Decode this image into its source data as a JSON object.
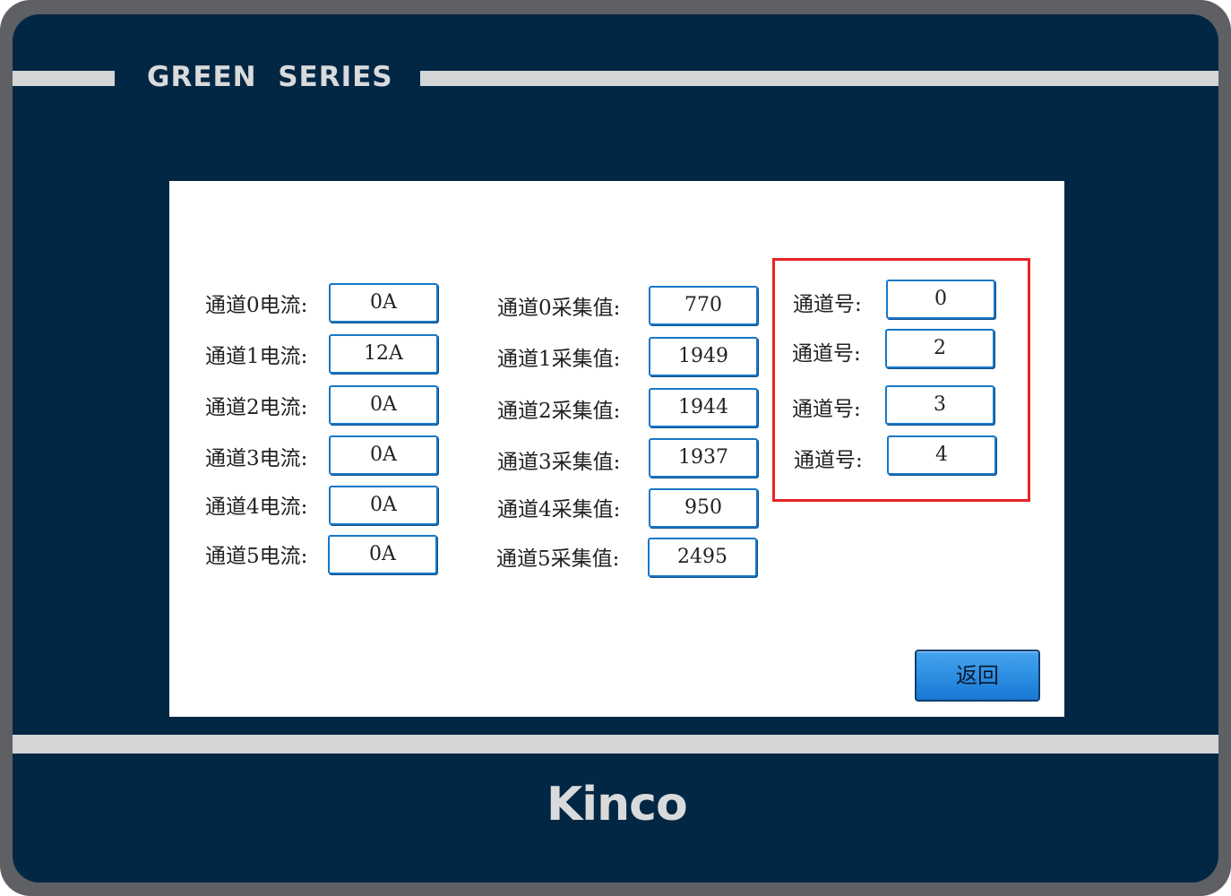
{
  "device": {
    "series_label": "GREEN  SERIES",
    "brand": "Kinco"
  },
  "current_rows": [
    {
      "label": "通道0电流:",
      "value": "0A"
    },
    {
      "label": "通道1电流:",
      "value": "12A"
    },
    {
      "label": "通道2电流:",
      "value": "0A"
    },
    {
      "label": "通道3电流:",
      "value": "0A"
    },
    {
      "label": "通道4电流:",
      "value": "0A"
    },
    {
      "label": "通道5电流:",
      "value": "0A"
    }
  ],
  "sample_rows": [
    {
      "label": "通道0采集值:",
      "value": "770"
    },
    {
      "label": "通道1采集值:",
      "value": "1949"
    },
    {
      "label": "通道2采集值:",
      "value": "1944"
    },
    {
      "label": "通道3采集值:",
      "value": "1937"
    },
    {
      "label": "通道4采集值:",
      "value": "950"
    },
    {
      "label": "通道5采集值:",
      "value": "2495"
    }
  ],
  "channel_rows": [
    {
      "label": "通道号:",
      "value": "0"
    },
    {
      "label": "通道号:",
      "value": "2"
    },
    {
      "label": "通道号:",
      "value": "3"
    },
    {
      "label": "通道号:",
      "value": "4"
    }
  ],
  "highlight_color": "#e62424",
  "back_button": {
    "label": "返回"
  }
}
